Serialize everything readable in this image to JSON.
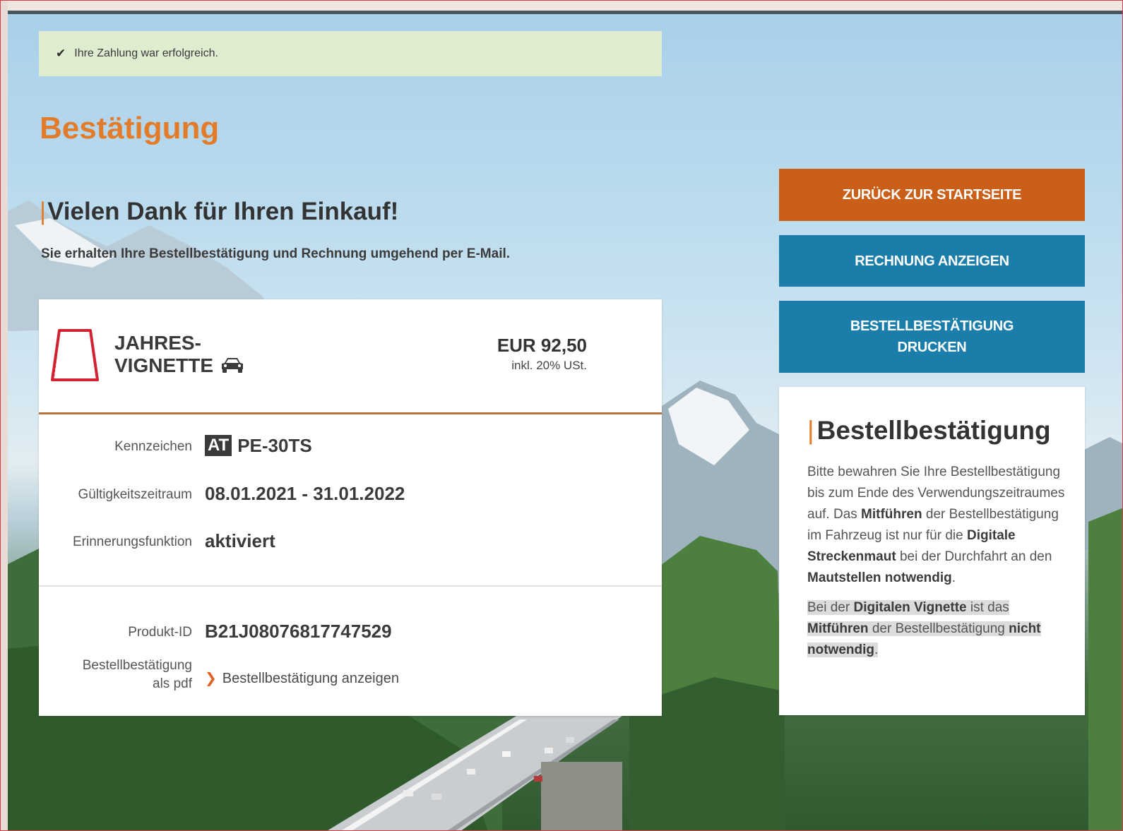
{
  "alert": {
    "icon": "check-icon",
    "text": "Ihre Zahlung war erfolgreich."
  },
  "page": {
    "title": "Bestätigung",
    "thanks": "Vielen Dank für Ihren Einkauf!",
    "subtitle": "Sie erhalten Ihre Bestellbestätigung und Rechnung umgehend per E-Mail."
  },
  "product": {
    "name_line1": "JAHRES-",
    "name_line2": "VIGNETTE",
    "vehicle_icon": "car-icon",
    "price": "EUR 92,50",
    "vat": "inkl. 20% USt."
  },
  "details": {
    "plate_label": "Kennzeichen",
    "plate_country": "AT",
    "plate_value": "PE-30TS",
    "validity_label": "Gültigkeitszeitraum",
    "validity_value": "08.01.2021 - 31.01.2022",
    "reminder_label": "Erinnerungsfunktion",
    "reminder_value": "aktiviert",
    "product_id_label": "Produkt-ID",
    "product_id_value": "B21J08076817747529",
    "pdf_label_line1": "Bestellbestätigung",
    "pdf_label_line2": "als pdf",
    "pdf_link": "Bestellbestätigung anzeigen"
  },
  "buttons": {
    "home": "ZURÜCK ZUR STARTSEITE",
    "invoice": "RECHNUNG ANZEIGEN",
    "print_line1": "BESTELLBESTÄTIGUNG",
    "print_line2": "DRUCKEN"
  },
  "info": {
    "title": "Bestellbestätigung",
    "p1_a": "Bitte bewahren Sie Ihre Bestellbestätigung bis zum Ende des Verwendungszeitraumes auf. Das ",
    "p1_b": "Mitführen",
    "p1_c": " der Bestellbestätigung im Fahrzeug ist nur für die ",
    "p1_d": "Digitale Streckenmaut",
    "p1_e": " bei der Durchfahrt an den ",
    "p1_f": "Mautstellen notwendig",
    "p1_g": ".",
    "p2_a": "Bei der ",
    "p2_b": "Digitalen Vignette",
    "p2_c": " ist das ",
    "p2_d": "Mitführen",
    "p2_e": " der Bestellbestätigung ",
    "p2_f": "nicht notwendig",
    "p2_g": "."
  },
  "colors": {
    "accent_orange": "#e37c2a",
    "home_button": "#c95f19",
    "blue_button": "#1b7eaa",
    "alert_bg": "#dfeccf"
  }
}
